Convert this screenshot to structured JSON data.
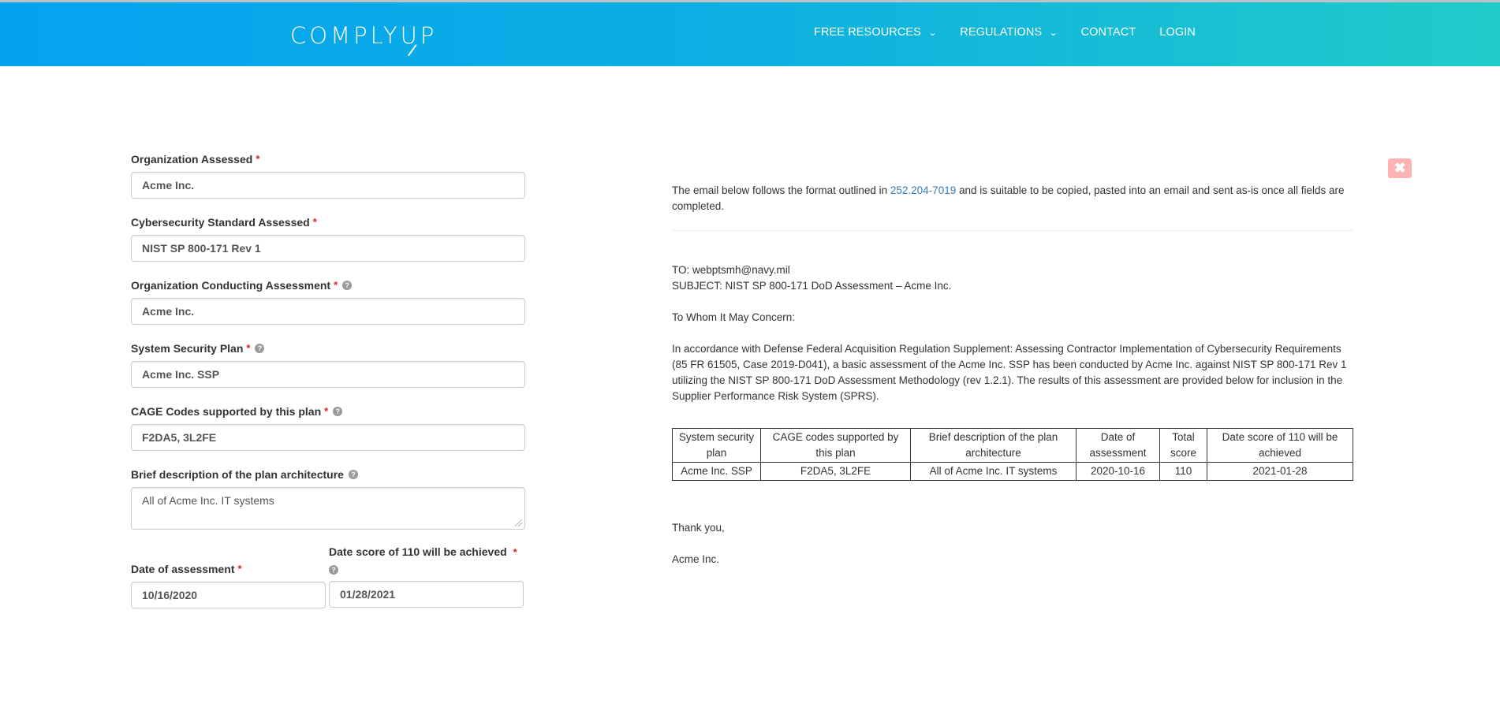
{
  "header": {
    "logo_text_1": "COMPLY",
    "logo_text_2": "UP",
    "nav": [
      {
        "label": "FREE RESOURCES",
        "has_dropdown": true
      },
      {
        "label": "REGULATIONS",
        "has_dropdown": true
      },
      {
        "label": "CONTACT",
        "has_dropdown": false
      },
      {
        "label": "LOGIN",
        "has_dropdown": false
      }
    ],
    "chevron_glyph": "⌄",
    "gradient_start": "#05a2f0",
    "gradient_end": "#22cbc9"
  },
  "form": {
    "required_mark": "*",
    "help_glyph": "?",
    "fields": {
      "org_assessed": {
        "label": "Organization Assessed",
        "value": "Acme Inc."
      },
      "standard": {
        "label": "Cybersecurity Standard Assessed",
        "value": "NIST SP 800-171 Rev 1"
      },
      "org_conducting": {
        "label": "Organization Conducting Assessment",
        "value": "Acme Inc."
      },
      "ssp": {
        "label": "System Security Plan",
        "value": "Acme Inc. SSP"
      },
      "cage": {
        "label": "CAGE Codes supported by this plan",
        "value": "F2DA5, 3L2FE"
      },
      "architecture": {
        "label": "Brief description of the plan architecture",
        "value": "All of Acme Inc. IT systems"
      },
      "date_assessment": {
        "label": "Date of assessment",
        "value": "10/16/2020"
      },
      "date_110": {
        "label": "Date score of 110 will be achieved",
        "value": "01/28/2021"
      }
    }
  },
  "email": {
    "close_glyph": "✖",
    "intro_before": "The email below follows the format outlined in ",
    "intro_link": "252.204-7019",
    "intro_after": " and is suitable to be copied, pasted into an email and sent as-is once all fields are completed.",
    "to": "TO: webptsmh@navy.mil",
    "subject": "SUBJECT: NIST SP 800-171 DoD Assessment – Acme Inc.",
    "greeting": "To Whom It May Concern:",
    "body": "In accordance with Defense Federal Acquisition Regulation Supplement: Assessing Contractor Implementation of Cybersecurity Requirements (85 FR 61505, Case 2019-D041), a basic assessment of the Acme Inc. SSP has been conducted by Acme Inc. against NIST SP 800-171 Rev 1 utilizing the NIST SP 800-171 DoD Assessment Methodology (rev 1.2.1). The results of this assessment are provided below for inclusion in the Supplier Performance Risk System (SPRS).",
    "table": {
      "headers": [
        "System security plan",
        "CAGE codes supported by this plan",
        "Brief description of the plan architecture",
        "Date of assessment",
        "Total score",
        "Date score of 110 will be achieved"
      ],
      "rows": [
        [
          "Acme Inc. SSP",
          "F2DA5, 3L2FE",
          "All of Acme Inc. IT systems",
          "2020-10-16",
          "110",
          "2021-01-28"
        ]
      ]
    },
    "closing": "Thank you,",
    "signature": "Acme Inc."
  }
}
